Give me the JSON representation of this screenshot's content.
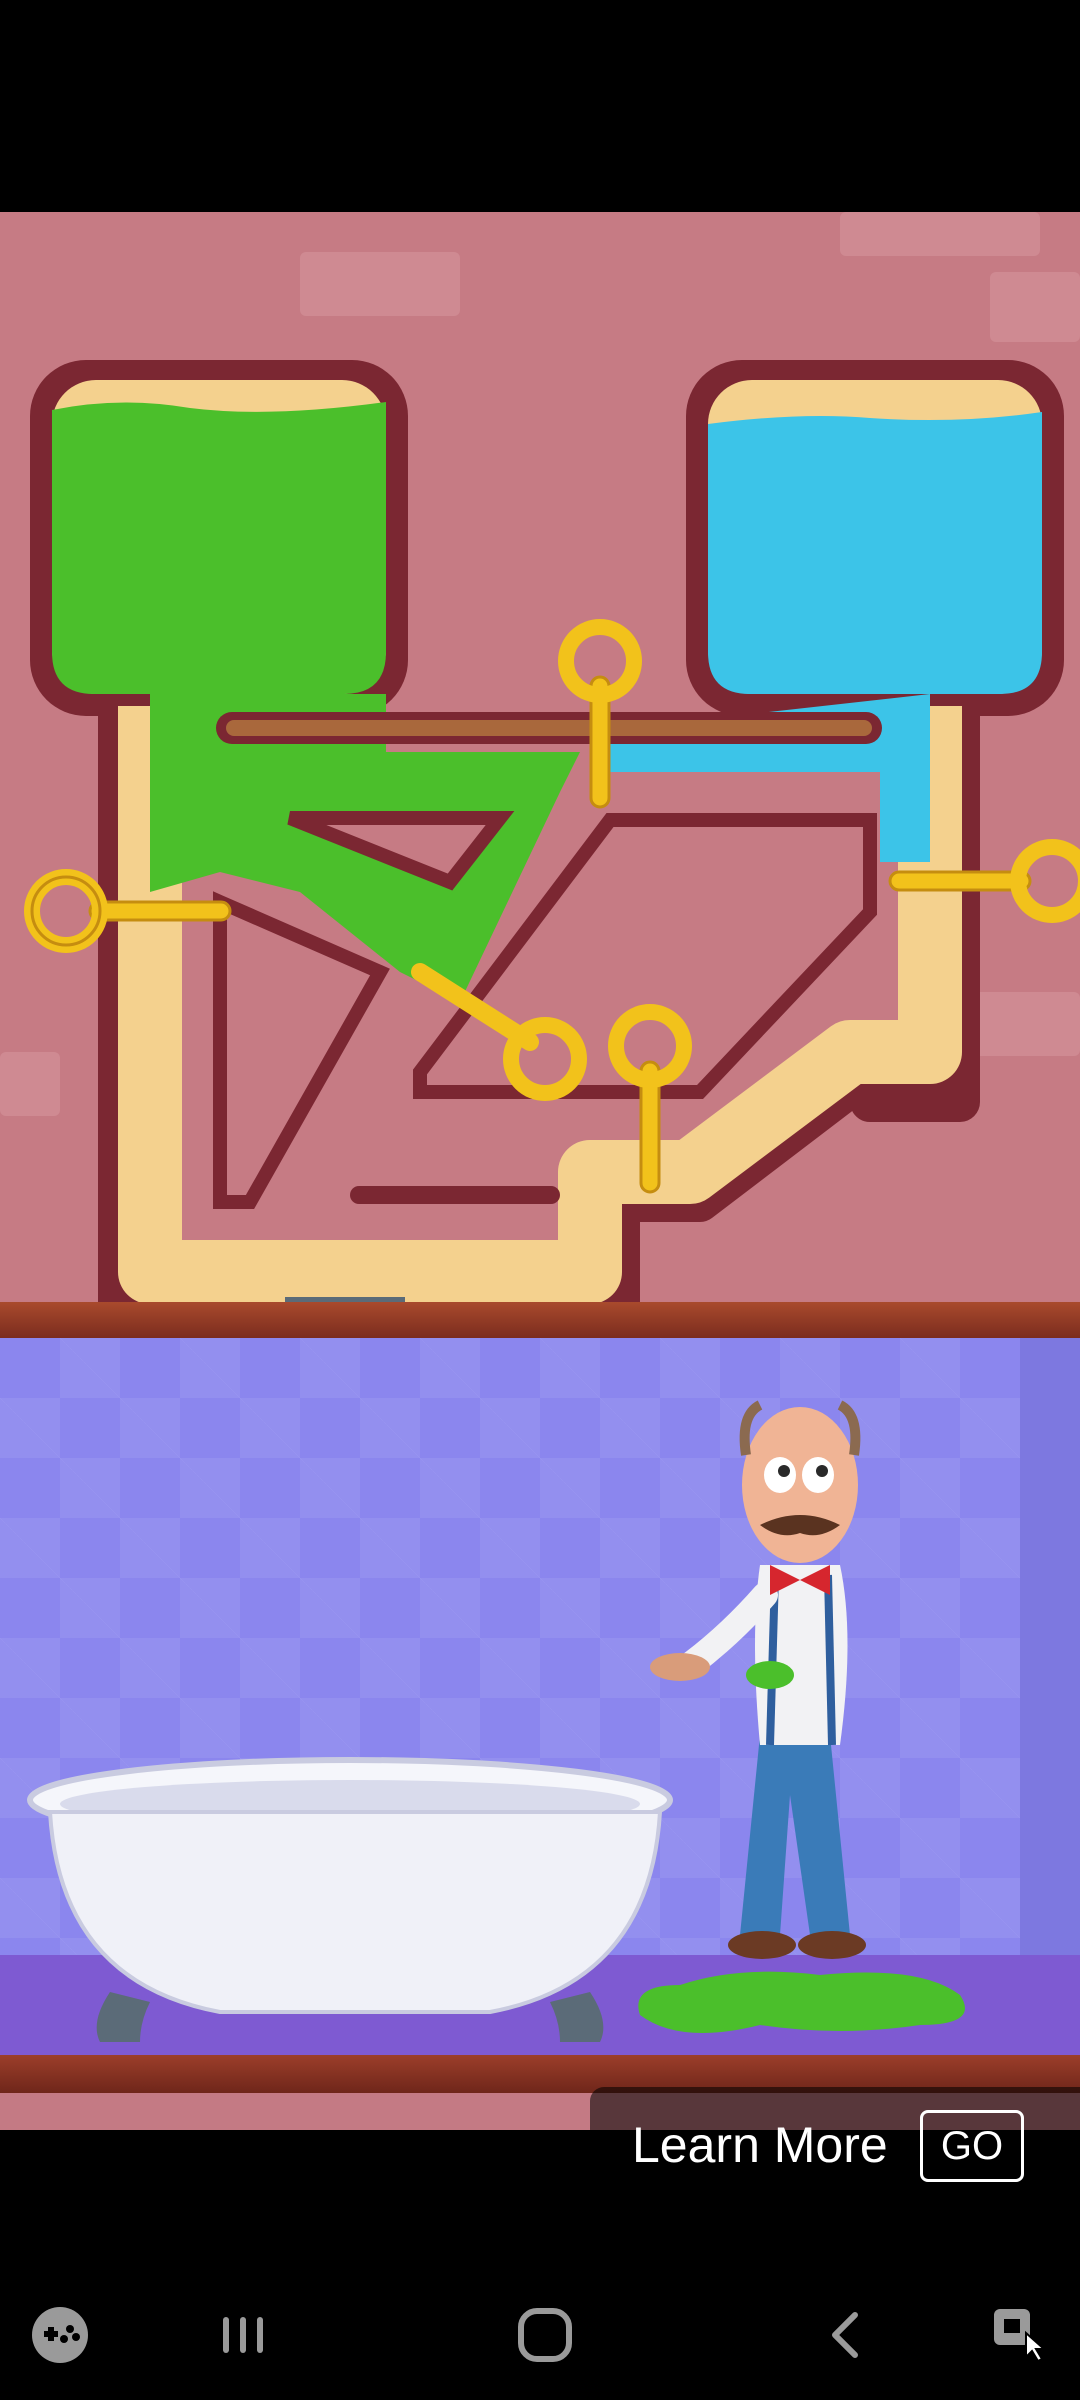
{
  "ad": {
    "learn_more": "Learn More",
    "go_label": "GO"
  },
  "scene": {
    "left_tank_liquid": "green-slime",
    "right_tank_liquid": "water",
    "pins": [
      "pin-left",
      "pin-top-center",
      "pin-right",
      "pin-diagonal",
      "pin-bottom-center"
    ],
    "character": "mustached-man",
    "fixture": "bathtub"
  },
  "navbar": {
    "icons": [
      "game-launcher-icon",
      "recent-apps-icon",
      "home-icon",
      "back-icon",
      "screen-capture-icon"
    ]
  },
  "colors": {
    "slime": "#4bbf2b",
    "water": "#3cc4e8",
    "pin_gold": "#f2c21b",
    "wall": "#c67b84",
    "tile": "#8b86ee"
  }
}
